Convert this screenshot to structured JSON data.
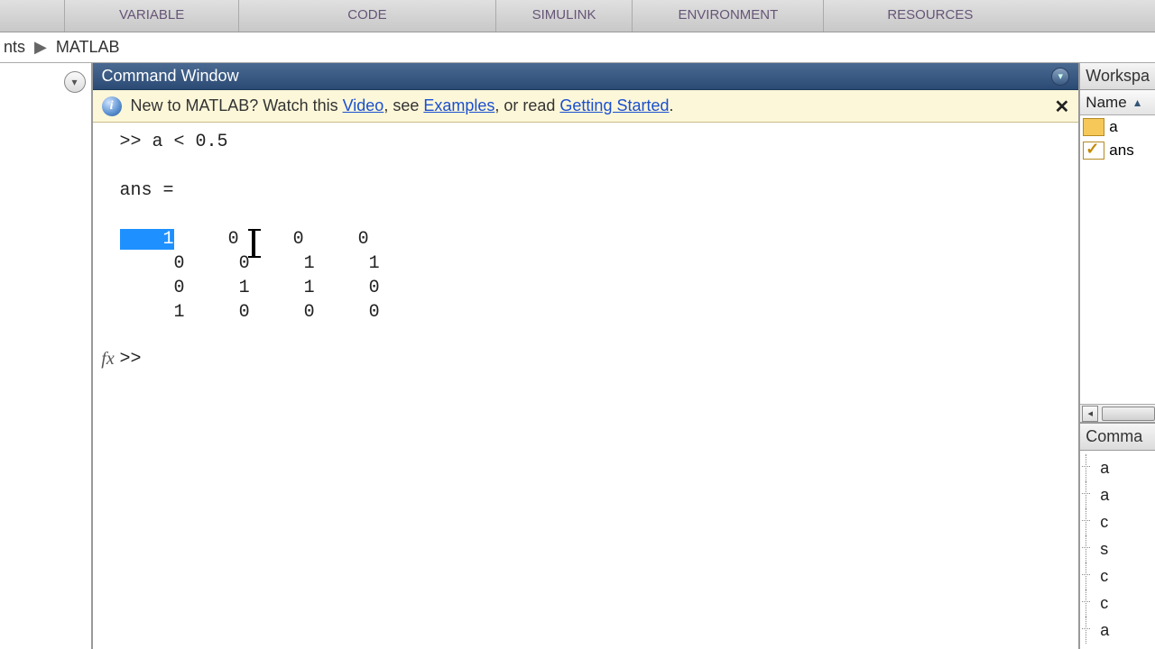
{
  "toolstrip": {
    "groups": [
      "VARIABLE",
      "CODE",
      "SIMULINK",
      "ENVIRONMENT",
      "RESOURCES"
    ]
  },
  "pathbar": {
    "seg1": "nts",
    "seg2": "MATLAB"
  },
  "commandWindow": {
    "title": "Command Window",
    "banner_prefix": "New to MATLAB? Watch this ",
    "banner_link1": "Video",
    "banner_mid1": ", see ",
    "banner_link2": "Examples",
    "banner_mid2": ", or read ",
    "banner_link3": "Getting Started",
    "banner_suffix": ".",
    "input_line": ">> a < 0.5",
    "ans_label": "ans =",
    "matrix": [
      [
        "1",
        "0",
        "0",
        "0"
      ],
      [
        "0",
        "0",
        "1",
        "1"
      ],
      [
        "0",
        "1",
        "1",
        "0"
      ],
      [
        "1",
        "0",
        "0",
        "0"
      ]
    ],
    "prompt": ">> "
  },
  "workspace": {
    "title": "Workspa",
    "col_name": "Name",
    "vars": [
      {
        "name": "a",
        "icon": "grid"
      },
      {
        "name": "ans",
        "icon": "check"
      }
    ]
  },
  "commandHistory": {
    "title": "Comma",
    "items": [
      "a",
      "a",
      "c",
      "s",
      "c",
      "c",
      "a"
    ]
  }
}
